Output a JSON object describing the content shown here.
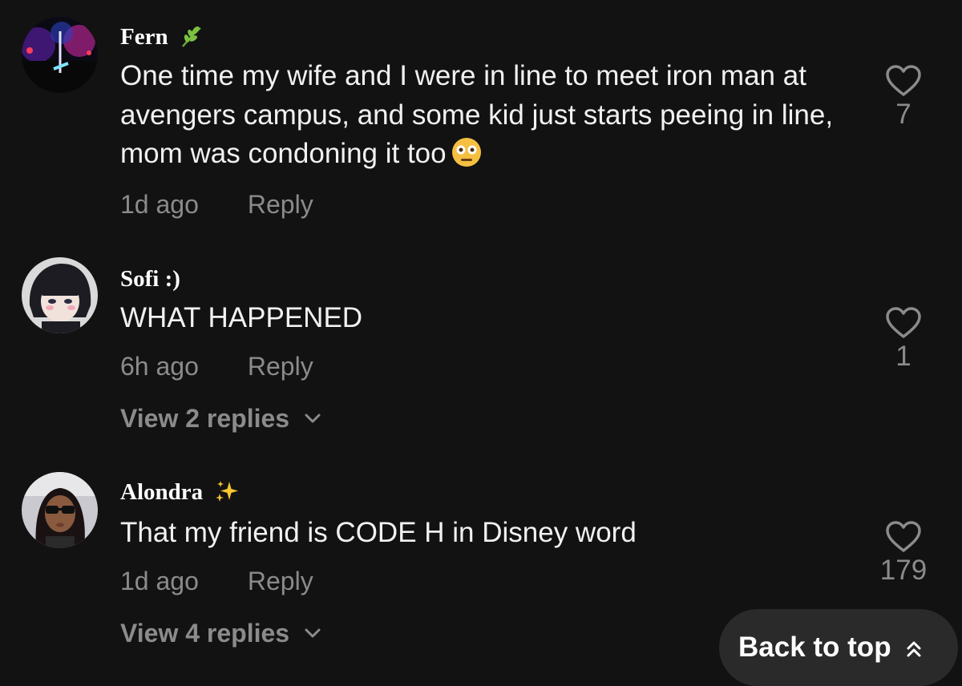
{
  "comments": [
    {
      "username": "Fern",
      "badge_icon": "leaf-icon",
      "text": "One time my wife and I were in line to meet iron man at avengers campus, and some kid just starts peeing in line, mom was condoning it too",
      "emoji_icon": "flushed-face-icon",
      "time": "1d ago",
      "reply_label": "Reply",
      "likes": "7"
    },
    {
      "username": "Sofi :)",
      "text": "WHAT HAPPENED",
      "time": "6h ago",
      "reply_label": "Reply",
      "likes": "1",
      "view_replies": "View 2 replies"
    },
    {
      "username": "Alondra",
      "badge_icon": "sparkles-icon",
      "text": "That my friend is CODE H in Disney word",
      "time": "1d ago",
      "reply_label": "Reply",
      "likes": "179",
      "view_replies": "View 4 replies"
    }
  ],
  "back_to_top": {
    "label": "Back to top",
    "icon": "double-chevron-up-icon"
  },
  "colors": {
    "background": "#121212",
    "text": "#f1f1f2",
    "muted": "#8b8b8b",
    "button_bg": "#2a2a2a"
  }
}
